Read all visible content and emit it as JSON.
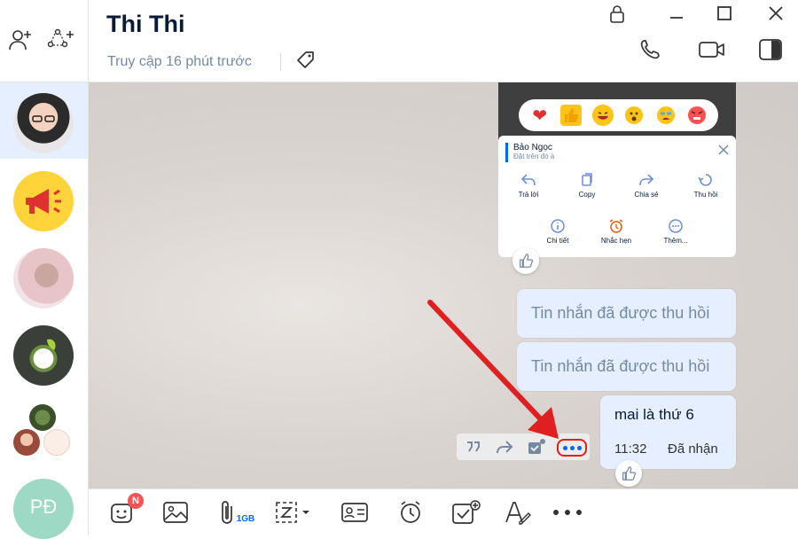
{
  "conversation": {
    "name": "Thi Thi",
    "last_seen": "Truy cập 16 phút trước"
  },
  "sidebar": {
    "avatars": [
      {
        "name": "conversation-avatar-1"
      },
      {
        "name": "conversation-avatar-2"
      },
      {
        "name": "conversation-avatar-3"
      },
      {
        "name": "conversation-avatar-4"
      },
      {
        "name": "conversation-avatar-group"
      }
    ],
    "profile_initials": "PĐ"
  },
  "message_menu": {
    "sender": "Bảo Ngọc",
    "preview": "Đặt trên đó à",
    "actions_row1": [
      "Trả lời",
      "Copy",
      "Chia sẻ",
      "Thu hồi"
    ],
    "actions_row2": [
      "Chi tiết",
      "Nhắc hẹn",
      "Thêm..."
    ]
  },
  "messages": [
    {
      "text": "Tin nhắn đã được thu hồi"
    },
    {
      "text": "Tin nhắn đã được thu hồi"
    },
    {
      "text": "mai là thứ 6",
      "time": "11:32",
      "status": "Đã nhận"
    }
  ],
  "toolbar": {
    "sticker_badge": "N",
    "file_limit": "1GB"
  },
  "colors": {
    "accent": "#0068ff",
    "bubble": "#e5efff",
    "annotation": "#e02020"
  }
}
